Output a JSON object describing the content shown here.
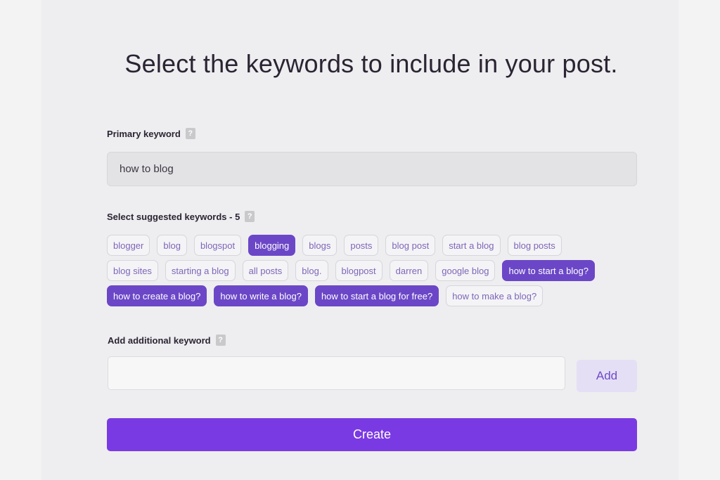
{
  "title": "Select the keywords to include in your post.",
  "primary": {
    "label": "Primary keyword",
    "help": "?",
    "value": "how to blog"
  },
  "suggested": {
    "label": "Select suggested keywords - 5",
    "help": "?",
    "rows": [
      [
        {
          "text": "blogger",
          "selected": false
        },
        {
          "text": "blog",
          "selected": false
        },
        {
          "text": "blogspot",
          "selected": false
        },
        {
          "text": "blogging",
          "selected": true
        },
        {
          "text": "blogs",
          "selected": false
        },
        {
          "text": "posts",
          "selected": false
        },
        {
          "text": "blog post",
          "selected": false
        },
        {
          "text": "start a blog",
          "selected": false
        },
        {
          "text": "blog posts",
          "selected": false
        }
      ],
      [
        {
          "text": "blog sites",
          "selected": false
        },
        {
          "text": "starting a blog",
          "selected": false
        },
        {
          "text": "all posts",
          "selected": false
        },
        {
          "text": "blog.",
          "selected": false
        },
        {
          "text": "blogpost",
          "selected": false
        },
        {
          "text": "darren",
          "selected": false
        },
        {
          "text": "google blog",
          "selected": false
        },
        {
          "text": "how to start a blog?",
          "selected": true
        }
      ],
      [
        {
          "text": "how to create a blog?",
          "selected": true
        },
        {
          "text": "how to write a blog?",
          "selected": true
        },
        {
          "text": "how to start a blog for free?",
          "selected": true
        },
        {
          "text": "how to make a blog?",
          "selected": false
        }
      ]
    ]
  },
  "additional": {
    "label": "Add additional keyword",
    "help": "?",
    "value": "",
    "add_label": "Add"
  },
  "create_label": "Create",
  "colors": {
    "accent": "#7a3ae3",
    "chip_selected": "#6b47c7",
    "chip_text": "#7e66b8"
  }
}
